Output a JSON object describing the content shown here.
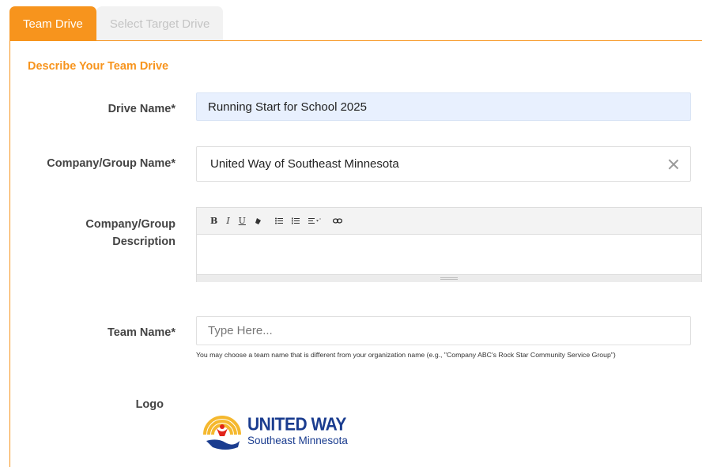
{
  "tabs": [
    {
      "label": "Team Drive",
      "active": true
    },
    {
      "label": "Select Target Drive",
      "active": false
    }
  ],
  "section_title": "Describe Your Team Drive",
  "fields": {
    "drive_name": {
      "label": "Drive Name*",
      "value": "Running Start for School 2025"
    },
    "company_name": {
      "label": "Company/Group Name*",
      "value": "United Way of Southeast Minnesota"
    },
    "company_description": {
      "label_line1": "Company/Group",
      "label_line2": "Description",
      "value": ""
    },
    "team_name": {
      "label": "Team Name*",
      "value": "",
      "placeholder": "Type Here...",
      "help": "You may choose a team name that is different from your organization name (e.g., \"Company ABC's Rock Star Community Service Group\")"
    },
    "logo": {
      "label": "Logo",
      "title": "UNITED WAY",
      "subtitle": "Southeast Minnesota"
    }
  },
  "toolbar": {
    "bold": "B",
    "italic": "I",
    "underline": "U",
    "eraser_icon": "eraser-icon",
    "ul_icon": "unordered-list-icon",
    "ol_icon": "ordered-list-icon",
    "align_icon": "align-dropdown-icon",
    "link_icon": "link-icon"
  },
  "colors": {
    "accent": "#f7941d",
    "filled_input": "#e8f0fe",
    "logo_blue": "#1a3c8f",
    "logo_yellow": "#f5b82e",
    "logo_red": "#e2231a"
  }
}
